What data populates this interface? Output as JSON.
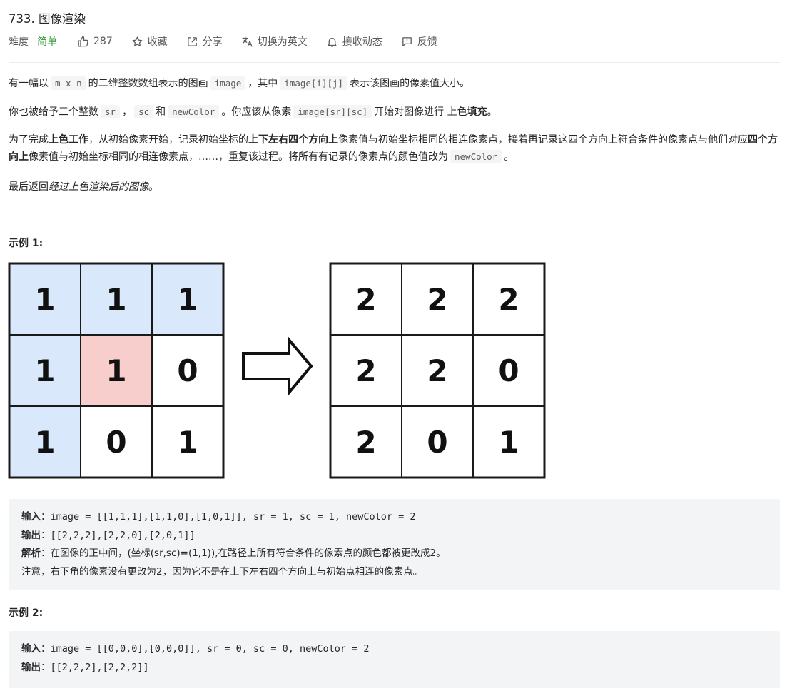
{
  "problem": {
    "number": "733.",
    "title": "图像渲染"
  },
  "meta": {
    "difficulty_label": "难度",
    "difficulty_value": "简单",
    "likes": "287",
    "favorite": "收藏",
    "share": "分享",
    "switch_lang": "切换为英文",
    "notify": "接收动态",
    "feedback": "反馈",
    "colors": {
      "easy": "#43a047"
    }
  },
  "desc": {
    "p1": {
      "t1": "有一幅以",
      "c1": "m x n",
      "t2": "的二维整数数组表示的图画",
      "c2": "image",
      "t3": "，其中",
      "c3": "image[i][j]",
      "t4": "表示该图画的像素值大小。"
    },
    "p2": {
      "t1": "你也被给予三个整数",
      "c1": "sr",
      "t2": "，",
      "c2": "sc",
      "t3": "和",
      "c3": "newColor",
      "t4": "。你应该从像素",
      "c4": "image[sr][sc]",
      "t5": "开始对图像进行 上色",
      "b1": "填充",
      "t6": "。"
    },
    "p3": {
      "t1": "为了完成",
      "b1": "上色工作",
      "t2": "，从初始像素开始，记录初始坐标的",
      "b2": "上下左右四个方向上",
      "t3": "像素值与初始坐标相同的相连像素点，接着再记录这四个方向上符合条件的像素点与他们对应",
      "b3": "四个方向上",
      "t4": "像素值与初始坐标相同的相连像素点，……，重复该过程。将所有有记录的像素点的颜色值改为",
      "c1": "newColor",
      "t5": "。"
    },
    "p4": {
      "t1": "最后返回",
      "i1": "经过上色渲染后的图像",
      "t2": "。"
    }
  },
  "example1": {
    "title": "示例 1:",
    "before": [
      [
        "1",
        "1",
        "1"
      ],
      [
        "1",
        "1",
        "0"
      ],
      [
        "1",
        "0",
        "1"
      ]
    ],
    "before_fill": [
      [
        "#dae8fc",
        "#dae8fc",
        "#dae8fc"
      ],
      [
        "#dae8fc",
        "#f8cecc",
        "#ffffff"
      ],
      [
        "#dae8fc",
        "#ffffff",
        "#ffffff"
      ]
    ],
    "after": [
      [
        "2",
        "2",
        "2"
      ],
      [
        "2",
        "2",
        "0"
      ],
      [
        "2",
        "0",
        "1"
      ]
    ],
    "input_label": "输入",
    "input": "image = [[1,1,1],[1,1,0],[1,0,1]], sr = 1, sc = 1, newColor = 2",
    "output_label": "输出",
    "output": "[[2,2,2],[2,2,0],[2,0,1]]",
    "explain_label": "解析",
    "explain": "在图像的正中间，(坐标(sr,sc)=(1,1)),在路径上所有符合条件的像素点的颜色都被更改成2。",
    "note": "注意，右下角的像素没有更改为2，因为它不是在上下左右四个方向上与初始点相连的像素点。"
  },
  "example2": {
    "title": "示例 2:",
    "input_label": "输入",
    "input": "image = [[0,0,0],[0,0,0]], sr = 0, sc = 0, newColor = 2",
    "output_label": "输出",
    "output": "[[2,2,2],[2,2,2]]"
  },
  "colon": "："
}
